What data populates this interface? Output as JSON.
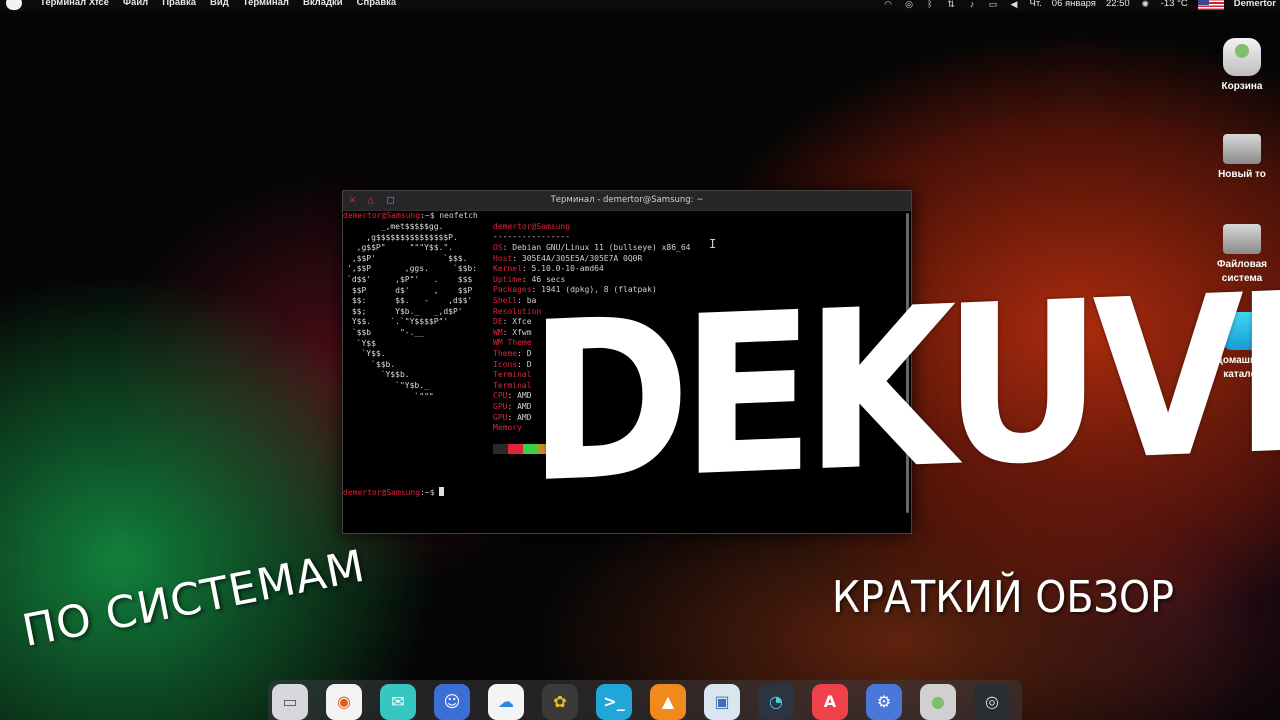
{
  "top_panel": {
    "menu": [
      "Терминал Xfce",
      "Файл",
      "Правка",
      "Вид",
      "Терминал",
      "Вкладки",
      "Справка"
    ],
    "weekday": "Чт.",
    "date": "06 января",
    "time": "22:50",
    "temperature": "-13 °C",
    "user": "Demertor"
  },
  "desktop_icons": [
    "Корзина",
    "Новый то",
    "Файловая система",
    "Домашний каталог"
  ],
  "terminal": {
    "title": "Терминал - demertor@Samsung: ~",
    "prompt_user": "demertor@Samsung",
    "prompt_suffix": ":~$ ",
    "command": "neofetch",
    "info_header": "demertor@Samsung",
    "separator": "----------------",
    "info": [
      {
        "key": "OS",
        "value": ": Debian GNU/Linux 11 (bullseye) x86_64"
      },
      {
        "key": "Host",
        "value": ": 305E4A/305E5A/305E7A 0Q0R"
      },
      {
        "key": "Kernel",
        "value": ": 5.10.0-10-amd64"
      },
      {
        "key": "Uptime",
        "value": ": 46 secs"
      },
      {
        "key": "Packages",
        "value": ": 1941 (dpkg), 8 (flatpak)"
      },
      {
        "key": "Shell",
        "value": ": ba"
      },
      {
        "key": "Resolution",
        "value": ""
      },
      {
        "key": "DE",
        "value": ": Xfce"
      },
      {
        "key": "WM",
        "value": ": Xfwm"
      },
      {
        "key": "WM Theme",
        "value": ""
      },
      {
        "key": "Theme",
        "value": ": D"
      },
      {
        "key": "Icons",
        "value": ": D"
      },
      {
        "key": "Terminal",
        "value": ""
      },
      {
        "key": "Terminal",
        "value": ""
      },
      {
        "key": "CPU",
        "value": ": AMD"
      },
      {
        "key": "GPU",
        "value": ": AMD"
      },
      {
        "key": "GPU",
        "value": ": AMD"
      },
      {
        "key": "Memory",
        "value": ""
      }
    ],
    "logo": [
      "       _,met$$$$$gg.",
      "    ,g$$$$$$$$$$$$$$$P.",
      "  ,g$$P\"     \"\"\"Y$$.\".",
      " ,$$P'              `$$$.",
      "',$$P       ,ggs.     `$$b:",
      "`d$$'     ,$P\"'   .    $$$",
      " $$P      d$'     ,    $$P",
      " $$:      $$.   -    ,d$$'",
      " $$;      Y$b._   _,d$P'",
      " Y$$.    `.`\"Y$$$$P\"'",
      " `$$b      \"-.__",
      "  `Y$$",
      "   `Y$$.",
      "     `$$b.",
      "       `Y$$b.",
      "          `\"Y$b._",
      "              `\"\"\""
    ]
  },
  "overlay": {
    "title": "DEKUVE",
    "left_caption": "ПО СИСТЕМАМ",
    "right_caption": "КРАТКИЙ ОБЗОР"
  },
  "dock": [
    {
      "name": "files",
      "symbol": "▭"
    },
    {
      "name": "firefox",
      "symbol": "◉"
    },
    {
      "name": "mail",
      "symbol": "✉"
    },
    {
      "name": "finder",
      "symbol": "☺"
    },
    {
      "name": "cloud",
      "symbol": "☁"
    },
    {
      "name": "photos",
      "symbol": "✿"
    },
    {
      "name": "terminal",
      "symbol": ">_"
    },
    {
      "name": "vlc",
      "symbol": "▲"
    },
    {
      "name": "image-viewer",
      "symbol": "▣"
    },
    {
      "name": "system-monitor",
      "symbol": "◔"
    },
    {
      "name": "app-store",
      "symbol": "A"
    },
    {
      "name": "settings",
      "symbol": "⚙"
    },
    {
      "name": "trash",
      "symbol": "●"
    },
    {
      "name": "obs",
      "symbol": "◎"
    }
  ],
  "colors": {
    "accent_red": "#e0233a",
    "terminal_bg": "#000000"
  }
}
